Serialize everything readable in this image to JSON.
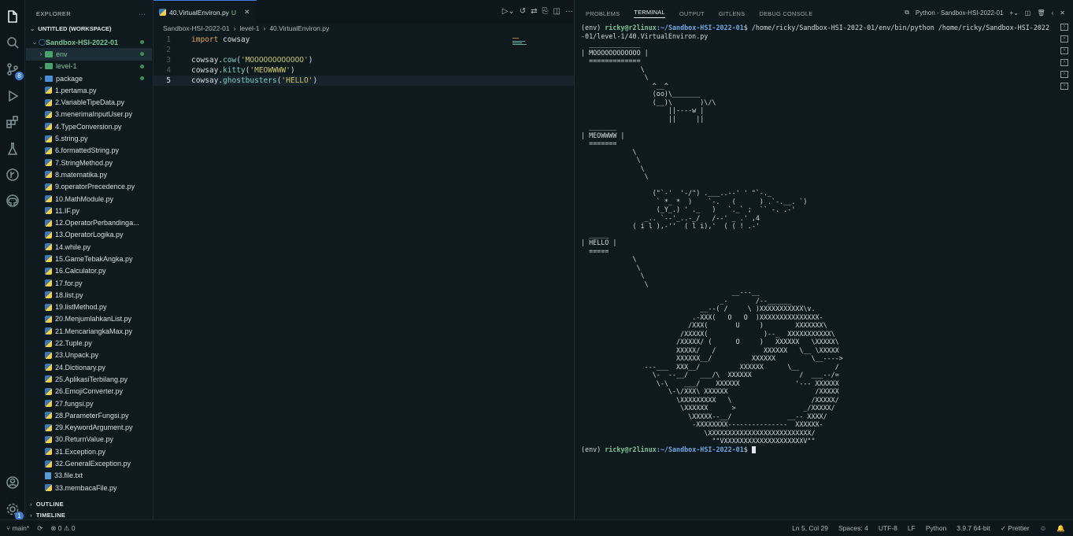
{
  "sidebar": {
    "title": "EXPLORER",
    "workspace": "UNTITLED (WORKSPACE)",
    "outline": "OUTLINE",
    "timeline": "TIMELINE",
    "items": [
      {
        "label": "Sandbox-HSI-2022-01",
        "type": "root",
        "depth": 0
      },
      {
        "label": "env",
        "type": "folder-g",
        "depth": 1,
        "closed": true
      },
      {
        "label": "level-1",
        "type": "folder-g",
        "depth": 1,
        "open": true
      },
      {
        "label": "package",
        "type": "folder",
        "depth": 2,
        "closed": true
      },
      {
        "label": "1.pertama.py",
        "type": "py",
        "depth": 3
      },
      {
        "label": "2.VariableTipeData.py",
        "type": "py",
        "depth": 3
      },
      {
        "label": "3.menerimaInputUser.py",
        "type": "py",
        "depth": 3
      },
      {
        "label": "4.TypeConversion.py",
        "type": "py",
        "depth": 3
      },
      {
        "label": "5.string.py",
        "type": "py",
        "depth": 3
      },
      {
        "label": "6.formattedString.py",
        "type": "py",
        "depth": 3
      },
      {
        "label": "7.StringMethod.py",
        "type": "py",
        "depth": 3
      },
      {
        "label": "8.matematika.py",
        "type": "py",
        "depth": 3
      },
      {
        "label": "9.operatorPrecedence.py",
        "type": "py",
        "depth": 3
      },
      {
        "label": "10.MathModule.py",
        "type": "py",
        "depth": 3
      },
      {
        "label": "11.IF.py",
        "type": "py",
        "depth": 3
      },
      {
        "label": "12.OperatorPerbandinga...",
        "type": "py",
        "depth": 3
      },
      {
        "label": "13.OperatorLogika.py",
        "type": "py",
        "depth": 3
      },
      {
        "label": "14.while.py",
        "type": "py",
        "depth": 3
      },
      {
        "label": "15.GameTebakAngka.py",
        "type": "py",
        "depth": 3
      },
      {
        "label": "16.Calculator.py",
        "type": "py",
        "depth": 3
      },
      {
        "label": "17.for.py",
        "type": "py",
        "depth": 3
      },
      {
        "label": "18.list.py",
        "type": "py",
        "depth": 3
      },
      {
        "label": "19.listMethod.py",
        "type": "py",
        "depth": 3
      },
      {
        "label": "20.MenjumlahkanList.py",
        "type": "py",
        "depth": 3
      },
      {
        "label": "21.MencariangkaMax.py",
        "type": "py",
        "depth": 3
      },
      {
        "label": "22.Tuple.py",
        "type": "py",
        "depth": 3
      },
      {
        "label": "23.Unpack.py",
        "type": "py",
        "depth": 3
      },
      {
        "label": "24.Dictionary.py",
        "type": "py",
        "depth": 3
      },
      {
        "label": "25.AplikasiTerbilang.py",
        "type": "py",
        "depth": 3
      },
      {
        "label": "26.EmojiConverter.py",
        "type": "py",
        "depth": 3
      },
      {
        "label": "27.fungsi.py",
        "type": "py",
        "depth": 3
      },
      {
        "label": "28.ParameterFungsi.py",
        "type": "py",
        "depth": 3
      },
      {
        "label": "29.KeywordArgument.py",
        "type": "py",
        "depth": 3
      },
      {
        "label": "30.ReturnValue.py",
        "type": "py",
        "depth": 3
      },
      {
        "label": "31.Exception.py",
        "type": "py",
        "depth": 3
      },
      {
        "label": "32.GeneralException.py",
        "type": "py",
        "depth": 3
      },
      {
        "label": "33.file.txt",
        "type": "txt",
        "depth": 3
      },
      {
        "label": "33.membacaFile.py",
        "type": "py",
        "depth": 3
      }
    ]
  },
  "editor": {
    "tab": "40.VirtualEnviron.py",
    "tab_mod": "U",
    "breadcrumb": [
      "Sandbox-HSI-2022-01",
      "level-1",
      "40.VirtualEnviron.py"
    ],
    "lines": [
      [
        [
          "kw",
          "import "
        ],
        [
          "pl",
          "cowsay"
        ]
      ],
      [],
      [
        [
          "pl",
          "cowsay."
        ],
        [
          "fn",
          "cow"
        ],
        [
          "pl",
          "("
        ],
        [
          "str",
          "'MOOOOOOOOOOOO'"
        ],
        [
          "pl",
          ")"
        ]
      ],
      [
        [
          "pl",
          "cowsay."
        ],
        [
          "fn",
          "kitty"
        ],
        [
          "pl",
          "("
        ],
        [
          "str",
          "'MEOWWWW'"
        ],
        [
          "pl",
          ")"
        ]
      ],
      [
        [
          "pl",
          "cowsay."
        ],
        [
          "fn",
          "ghostbusters"
        ],
        [
          "pl",
          "("
        ],
        [
          "str",
          "'HELLO'"
        ],
        [
          "pl",
          ")"
        ]
      ]
    ]
  },
  "panel": {
    "tabs": [
      "PROBLEMS",
      "TERMINAL",
      "OUTPUT",
      "GITLENS",
      "DEBUG CONSOLE"
    ],
    "active": "TERMINAL",
    "profile": "Python - Sandbox-HSI-2022-01"
  },
  "terminal": {
    "env": "(env) ",
    "user": "ricky@r2linux",
    "path": ":~/Sandbox-HSI-2022-01",
    "cmd": "$ /home/ricky/Sandbox-HSI-2022-01/env/bin/python /home/ricky/Sandbox-HSI-2022\n-01/level-1/40.VirtualEnviron.py",
    "output": "  _____________\n| MOOOOOOOOOOOO |\n  =============\n               \\\n                \\\n                  ^__^\n                  (oo)\\_______\n                  (__)\\       )\\/\\\n                      ||----w |\n                      ||     ||\n  _______\n| MEOWWWW |\n  =======\n             \\\n              \\\n               \\\n                \\\n\n                  (\"`-'  '-/\") .___..--' ' \"`-._\n                   ` *_ *  )    `-.   (      ) .`-.__. `)\n                   (_Y_.) ' ._   )   `._` ;  `` -. .-'\n                _.. `--'_..-_/   /--' _ .' ,4\n             ( i l ),-''  ( l i),'  ( ( ! .-'\n  _____\n| HELLO |\n  =====\n             \\\n              \\\n               \\\n                \\\n                                      __---__\n                                   _-       /--______\n                              __--( /     \\ )XXXXXXXXXXX\\v.\n                            .-XXX(   O   O  )XXXXXXXXXXXXXXX-\n                           /XXX(       U     )        XXXXXXX\\\n                         /XXXXX(              )--_  XXXXXXXXXXX\\\n                        /XXXXX/ (      O     )   XXXXXX   \\XXXXX\\\n                        XXXXX/   /            XXXXXX   \\__ \\XXXXX\n                        XXXXXX__/          XXXXXX         \\__---->\n                ---___  XXX__/          XXXXXX      \\__         /\n                  \\-  --__/   ___/\\  XXXXXX            /  ___--/=\n                   \\-\\    ___/    XXXXXX              '--- XXXXXX\n                      \\-\\/XXX\\ XXXXXX                      /XXXXX\n                        \\XXXXXXXXX   \\                    /XXXXX/\n                         \\XXXXXX      >                 _/XXXXX/\n                           \\XXXXX--__/              __-- XXXX/\n                            -XXXXXXXX---------------  XXXXXX-\n                               \\XXXXXXXXXXXXXXXXXXXXXXXXXX/\n                                 \"\"VXXXXXXXXXXXXXXXXXXXXV\"\"",
    "prompt_env": "(env) ",
    "prompt_user": "ricky@r2linux",
    "prompt_path": ":~/Sandbox-HSI-2022-01",
    "prompt_end": "$ "
  },
  "status": {
    "branch": "main*",
    "errors": "⊗ 0 ⚠ 0",
    "pos": "Ln 5, Col 29",
    "spaces": "Spaces: 4",
    "enc": "UTF-8",
    "eol": "LF",
    "lang": "Python",
    "ver": "3.9.7 64-bit",
    "prettier": "✓ Prettier"
  }
}
